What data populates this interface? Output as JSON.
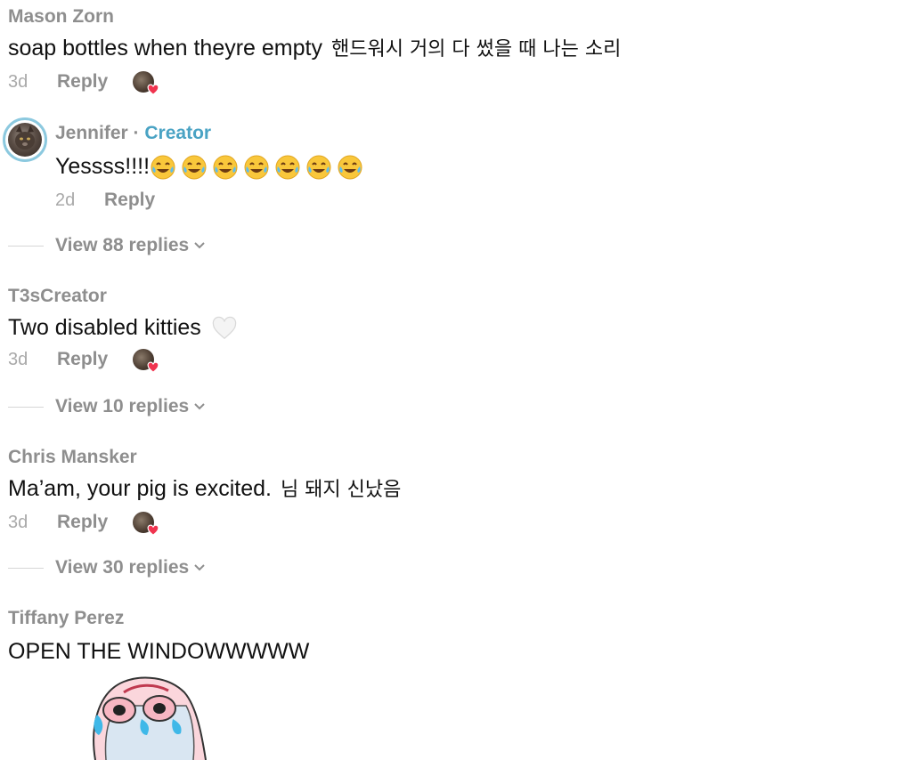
{
  "comments": [
    {
      "user": "Mason Zorn",
      "text": "soap bottles when theyre empty",
      "translation": "핸드워시 거의 다 썼을 때 나는 소리",
      "time": "3d",
      "reply": "Reply"
    },
    {
      "user": "T3sCreator",
      "text": "Two disabled kitties",
      "time": "3d",
      "reply": "Reply"
    },
    {
      "user": "Chris Mansker",
      "text": "Ma’am, your pig is excited.",
      "translation": "님 돼지 신났음",
      "time": "3d",
      "reply": "Reply"
    },
    {
      "user": "Tiffany Perez",
      "text": "OPEN THE WINDOWWWWW"
    }
  ],
  "creator_reply": {
    "user": "Jennifer",
    "separator": " · ",
    "badge": "Creator",
    "text": "Yessss!!!!",
    "emoji": "face-with-tears-of-joy",
    "emoji_count": 7,
    "time": "2d",
    "reply": "Reply"
  },
  "view_replies": [
    {
      "label": "View 88 replies"
    },
    {
      "label": "View 10 replies"
    },
    {
      "label": "View 30 replies"
    }
  ],
  "colors": {
    "username": "#8e8e8e",
    "creator_badge": "#4aa3c4",
    "text": "#111111",
    "time": "#a9a9a9",
    "heart": "#f0344f"
  }
}
